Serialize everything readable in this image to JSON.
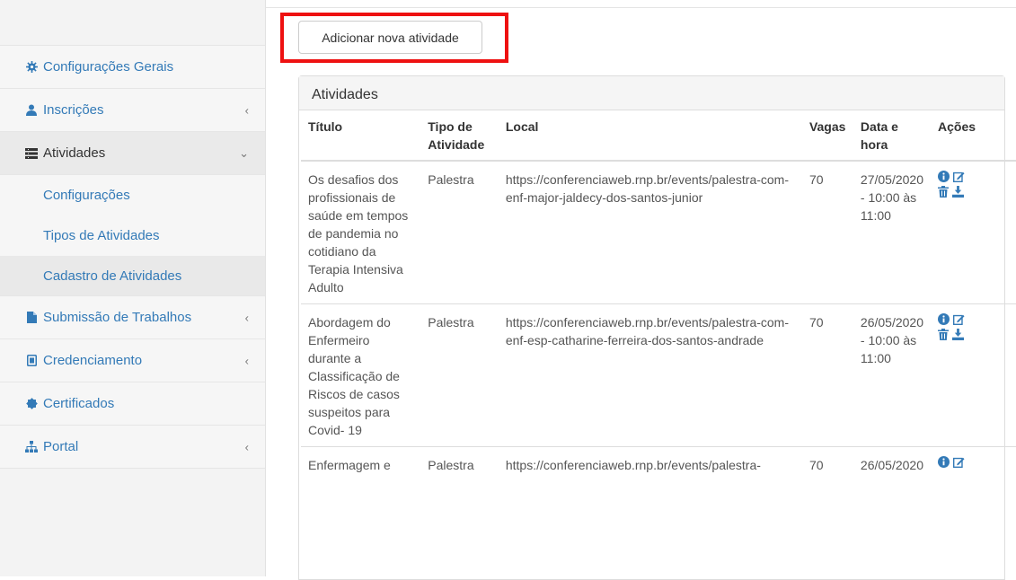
{
  "sidebar": {
    "items": [
      {
        "label": "Configurações Gerais",
        "icon": "gear-icon",
        "chevron": ""
      },
      {
        "label": "Inscrições",
        "icon": "user-icon",
        "chevron": "‹"
      },
      {
        "label": "Atividades",
        "icon": "list-icon",
        "chevron": "⌄"
      },
      {
        "label": "Submissão de Trabalhos",
        "icon": "file-icon",
        "chevron": "‹"
      },
      {
        "label": "Credenciamento",
        "icon": "badge-icon",
        "chevron": "‹"
      },
      {
        "label": "Certificados",
        "icon": "certificate-icon",
        "chevron": ""
      },
      {
        "label": "Portal",
        "icon": "sitemap-icon",
        "chevron": "‹"
      }
    ],
    "submenu": [
      {
        "label": "Configurações"
      },
      {
        "label": "Tipos de Atividades"
      },
      {
        "label": "Cadastro de Atividades"
      }
    ]
  },
  "main": {
    "add_button": "Adicionar nova atividade",
    "panel_title": "Atividades",
    "table": {
      "headers": [
        "Título",
        "Tipo de Atividade",
        "Local",
        "Vagas",
        "Data e hora",
        "Ações"
      ],
      "rows": [
        {
          "titulo": "Os desafios dos profissionais de saúde em tempos de pandemia no cotidiano da Terapia Intensiva Adulto",
          "tipo": "Palestra",
          "local": "https://conferenciaweb.rnp.br/events/palestra-com-enf-major-jaldecy-dos-santos-junior",
          "vagas": "70",
          "data": "27/05/2020 - 10:00 às 11:00"
        },
        {
          "titulo": "Abordagem do Enfermeiro durante a Classificação de Riscos de casos suspeitos para Covid- 19",
          "tipo": "Palestra",
          "local": "https://conferenciaweb.rnp.br/events/palestra-com-enf-esp-catharine-ferreira-dos-santos-andrade",
          "vagas": "70",
          "data": "26/05/2020 - 10:00 às 11:00"
        },
        {
          "titulo": "Enfermagem e",
          "tipo": "Palestra",
          "local": "https://conferenciaweb.rnp.br/events/palestra-",
          "vagas": "70",
          "data": "26/05/2020"
        }
      ]
    }
  },
  "colors": {
    "link": "#337ab7",
    "highlight": "#ee1111"
  }
}
